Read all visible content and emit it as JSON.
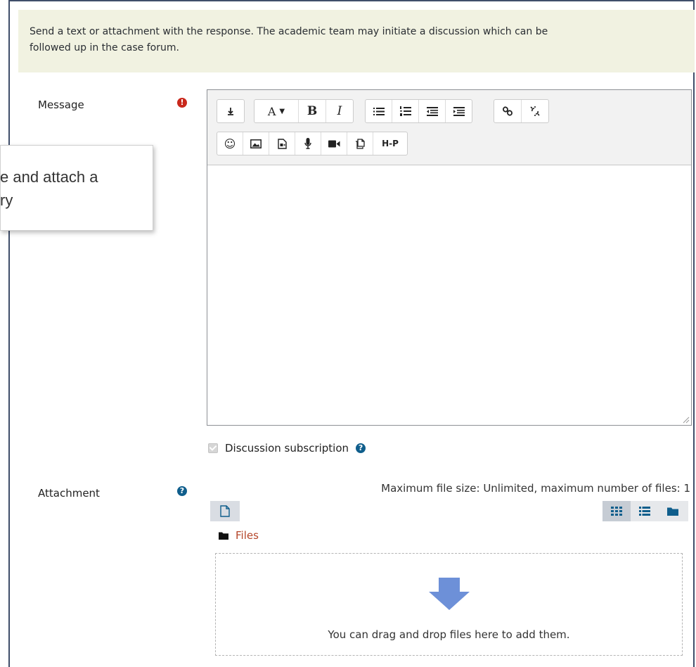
{
  "notice": {
    "line1": "Send a text or attachment with the response. The academic team may initiate a discussion which can be",
    "line2": "followed up in the case forum."
  },
  "message": {
    "label": "Message",
    "required_icon": "!",
    "toolbar_row1": [
      {
        "name": "collapse-button",
        "icon": "↧"
      },
      {
        "name": "font-size-button",
        "text": "A ▾"
      },
      {
        "name": "bold-button",
        "text": "B"
      },
      {
        "name": "italic-button",
        "text": "I"
      },
      {
        "name": "unordered-list-button",
        "icon": "≣"
      },
      {
        "name": "ordered-list-button",
        "icon": "≣"
      },
      {
        "name": "outdent-button",
        "icon": "≣"
      },
      {
        "name": "indent-button",
        "icon": "≣"
      },
      {
        "name": "link-button",
        "icon": "link"
      },
      {
        "name": "unlink-button",
        "icon": "unlink"
      }
    ],
    "toolbar_row2": [
      {
        "name": "emoji-button",
        "icon": "☺"
      },
      {
        "name": "image-button",
        "icon": "image"
      },
      {
        "name": "media-button",
        "icon": "media"
      },
      {
        "name": "record-audio-button",
        "icon": "mic"
      },
      {
        "name": "record-video-button",
        "icon": "video"
      },
      {
        "name": "manage-files-button",
        "icon": "files"
      },
      {
        "name": "h5p-button",
        "text": "H-P"
      }
    ]
  },
  "tooltip": {
    "line1": "e and attach a",
    "line2": "ry"
  },
  "subscription": {
    "label": "Discussion subscription",
    "help_icon": "?"
  },
  "attachment": {
    "label": "Attachment",
    "help_icon": "?",
    "max_info": "Maximum file size: Unlimited, maximum number of files: 1",
    "folder_name": "Files",
    "drop_text": "You can drag and drop files here to add them."
  },
  "colors": {
    "notice_bg": "#f1f2e1",
    "required": "#c9281c",
    "help": "#0f5e8c",
    "files_link": "#b5462a",
    "drop_arrow": "#6d90d8"
  }
}
